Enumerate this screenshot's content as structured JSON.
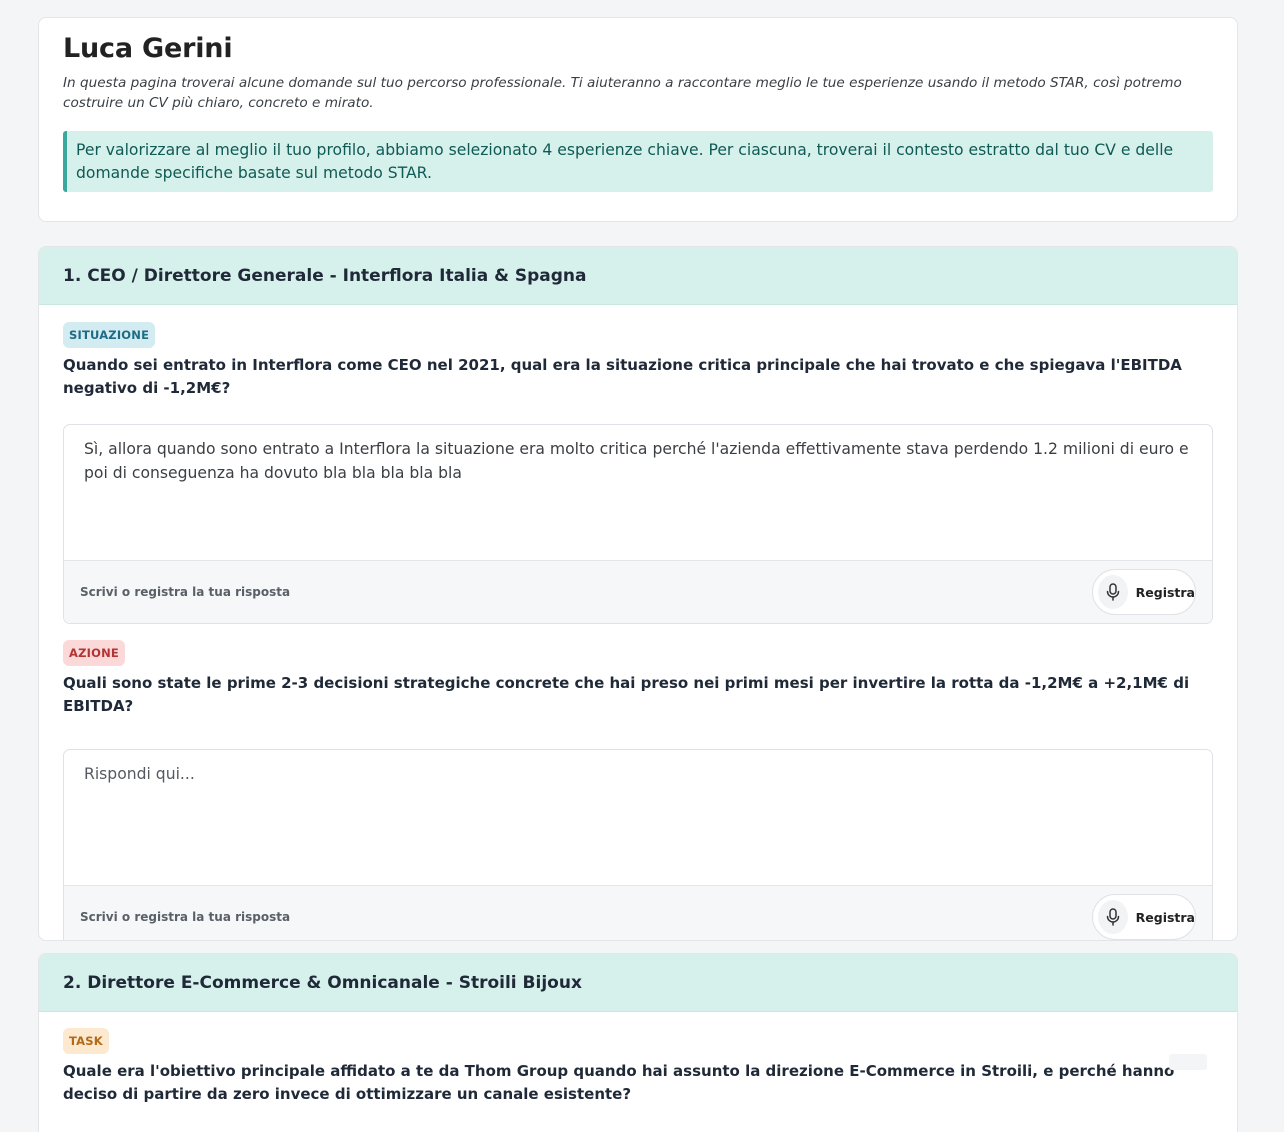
{
  "intro": {
    "name": "Luca Gerini",
    "lead": "In questa pagina troverai alcune domande sul tuo percorso professionale. Ti aiuteranno a raccontare meglio le tue esperienze usando il metodo STAR, così potremo costruire un CV più chiaro, concreto e mirato.",
    "callout": "Per valorizzare al meglio il tuo profilo, abbiamo selezionato 4 esperienze chiave. Per ciascuna, troverai il contesto estratto dal tuo CV e delle domande specifiche basate sul metodo STAR."
  },
  "sections": [
    {
      "title": "1. CEO / Direttore Generale - Interflora Italia & Spagna",
      "questions": [
        {
          "tag": "SITUAZIONE",
          "tag_color": "#1f6b85",
          "text": "Quando sei entrato in Interflora come CEO nel 2021, qual era la situazione critica principale che hai trovato e che spiegava l'EBITDA negativo di -1,2M€?",
          "answer": "Sì, allora quando sono entrato a Interflora la situazione era molto critica perché l'azienda effettivamente stava perdendo 1.2 milioni di euro e poi di conseguenza ha dovuto bla bla bla bla bla",
          "hint": "Scrivi o registra la tua risposta",
          "record_label": "Registra"
        },
        {
          "tag": "AZIONE",
          "tag_color": "#b23434",
          "text": "Quali sono state le prime 2-3 decisioni strategiche concrete che hai preso nei primi mesi per invertire la rotta da -1,2M€ a +2,1M€ di EBITDA?",
          "placeholder": "Rispondi qui...",
          "hint": "Scrivi o registra la tua risposta",
          "record_label": "Registra"
        }
      ]
    },
    {
      "title": "2. Direttore E-Commerce & Omnicanale - Stroili Bijoux",
      "questions": [
        {
          "tag": "TASK",
          "tag_color": "#b26a19",
          "text": "Quale era l'obiettivo principale affidato a te da Thom Group quando hai assunto la direzione E-Commerce in Stroili, e perché hanno deciso di partire da zero invece di ottimizzare un canale esistente?"
        }
      ]
    }
  ],
  "icons": {
    "record": "microphone-icon"
  }
}
